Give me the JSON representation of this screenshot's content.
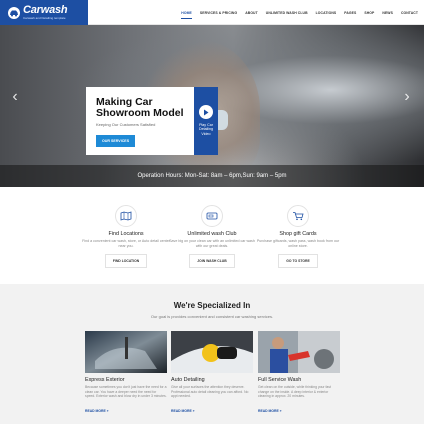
{
  "brand": {
    "name": "Carwash",
    "tagline": "Carwash and Detailing template",
    "color": "#1d4fa3"
  },
  "nav": {
    "items": [
      "HOME",
      "SERVICES & PRICING",
      "ABOUT",
      "UNLIMITED WASH CLUB",
      "LOCATIONS",
      "PAGES",
      "SHOP",
      "NEWS",
      "CONTACT"
    ],
    "active": "HOME"
  },
  "hero": {
    "title_line1": "Making Car",
    "title_line2": "Showroom Model",
    "subtitle": "Keeping Our Customers Satisfied",
    "button": "OUR SERVICES",
    "play_label": "Play Car Detailing Video",
    "hours": "Operation Hours: Mon-Sat: 8am – 6pm,Sun: 9am – 5pm",
    "prev_icon": "chevron-left-icon",
    "next_icon": "chevron-right-icon"
  },
  "features": [
    {
      "icon": "map-icon",
      "title": "Find Locations",
      "desc": "Find a convenient car wash, store, or Auto detail center near you.",
      "button": "FIND LOCATION"
    },
    {
      "icon": "wash-card-icon",
      "title": "Unlimited wash Club",
      "desc": "Save big on your clean car with an unlimited car wash with our great deals.",
      "button": "JOIN WASH CLUB"
    },
    {
      "icon": "cart-icon",
      "title": "Shop gift Cards",
      "desc": "Purchase giftcards, wash pass, wash book from our online store.",
      "button": "GO TO STORE"
    }
  ],
  "specialized": {
    "title": "We're Specialized In",
    "subtitle": "Our goal is provides convenient and consistent car washing services.",
    "services": [
      {
        "title": "Express Exterior",
        "desc": "Because sometimes you don't just have the need for a clean car. You have a deeper need the need for speed. Exterior wash and blow dry in under 3 minutes.",
        "link": "READ MORE »"
      },
      {
        "title": "Auto Detailing",
        "desc": "Give all your surfaces the attention they deserve. Professional auto detail cleaning you can afford. No appt needed.",
        "link": "READ MORE »"
      },
      {
        "title": "Full Service Wash",
        "desc": "Get clean on the outside, while thinking your fast change on the inside. A deep interior & exterior cleaning in approx. 20 minutes.",
        "link": "READ MORE »"
      }
    ]
  },
  "accent": "#1e8ad6"
}
